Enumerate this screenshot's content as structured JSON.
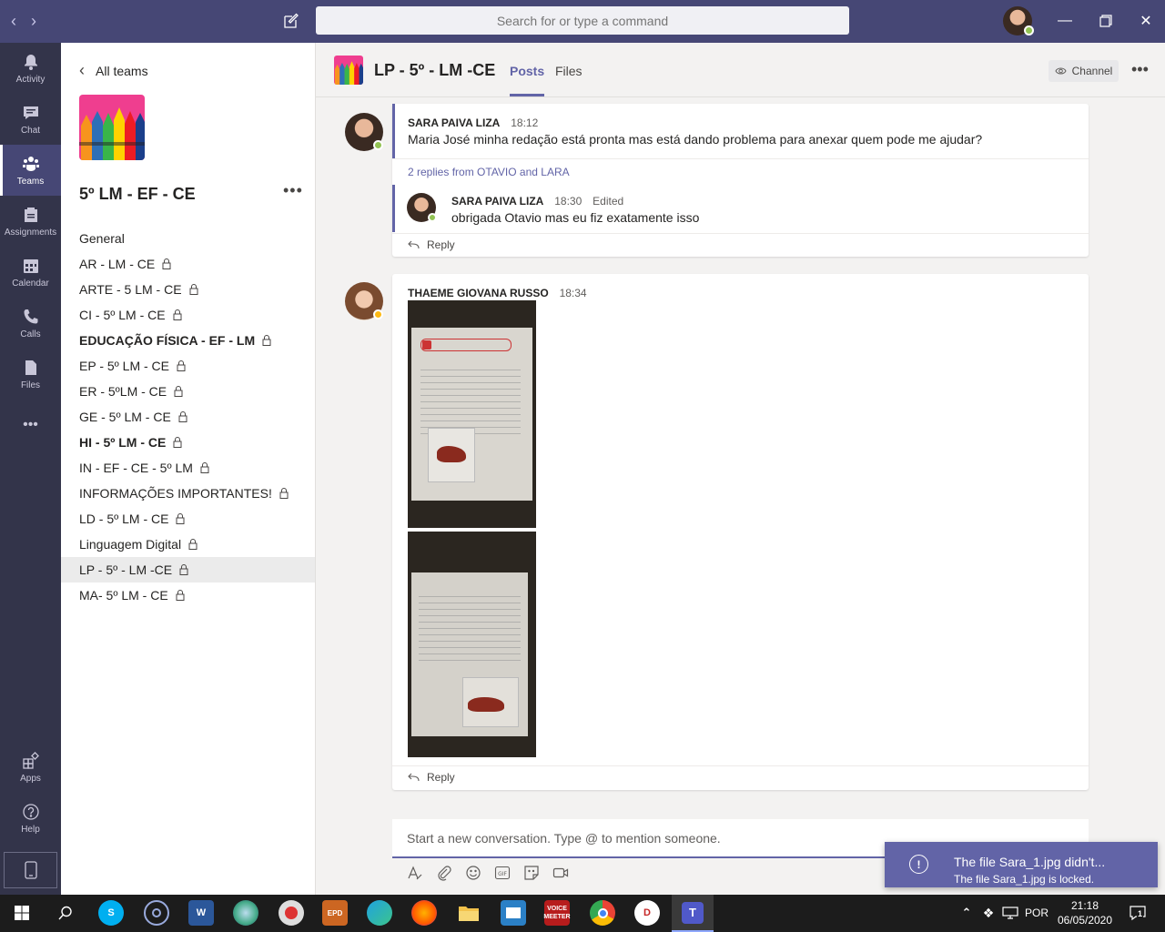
{
  "titlebar": {
    "search_placeholder": "Search for or type a command"
  },
  "appbar": {
    "items": [
      {
        "label": "Activity",
        "icon": "bell-icon"
      },
      {
        "label": "Chat",
        "icon": "chat-icon"
      },
      {
        "label": "Teams",
        "icon": "teams-icon"
      },
      {
        "label": "Assignments",
        "icon": "assignments-icon"
      },
      {
        "label": "Calendar",
        "icon": "calendar-icon"
      },
      {
        "label": "Calls",
        "icon": "phone-icon"
      },
      {
        "label": "Files",
        "icon": "file-icon"
      }
    ],
    "more": "•••",
    "bottom": [
      {
        "label": "Apps",
        "icon": "apps-icon"
      },
      {
        "label": "Help",
        "icon": "help-icon"
      }
    ]
  },
  "teampanel": {
    "back_label": "All teams",
    "team_name": "5º LM - EF - CE",
    "more": "•••",
    "channels": [
      {
        "name": "General",
        "locked": false,
        "bold": false
      },
      {
        "name": "AR - LM - CE",
        "locked": true,
        "bold": false
      },
      {
        "name": "ARTE - 5 LM - CE",
        "locked": true,
        "bold": false
      },
      {
        "name": "CI - 5º LM - CE",
        "locked": true,
        "bold": false
      },
      {
        "name": "EDUCAÇÃO FÍSICA - EF - LM",
        "locked": true,
        "bold": true
      },
      {
        "name": "EP - 5º LM - CE",
        "locked": true,
        "bold": false
      },
      {
        "name": "ER - 5ºLM - CE",
        "locked": true,
        "bold": false
      },
      {
        "name": "GE - 5º LM - CE",
        "locked": true,
        "bold": false
      },
      {
        "name": "HI - 5º LM - CE",
        "locked": true,
        "bold": true
      },
      {
        "name": "IN - EF - CE - 5º LM",
        "locked": true,
        "bold": false
      },
      {
        "name": "INFORMAÇÕES IMPORTANTES!",
        "locked": true,
        "bold": false
      },
      {
        "name": "LD - 5º LM - CE",
        "locked": true,
        "bold": false
      },
      {
        "name": "Linguagem Digital",
        "locked": true,
        "bold": false
      },
      {
        "name": "LP - 5º - LM -CE",
        "locked": true,
        "bold": false,
        "selected": true
      },
      {
        "name": "MA- 5º LM - CE",
        "locked": true,
        "bold": false
      }
    ]
  },
  "channel_header": {
    "title": "LP - 5º - LM -CE",
    "tabs": [
      "Posts",
      "Files"
    ],
    "active_tab": "Posts",
    "channel_button": "Channel",
    "more": "•••"
  },
  "posts": [
    {
      "author": "SARA PAIVA LIZA",
      "time": "18:12",
      "text": "Maria José minha redação está pronta mas está dando problema para anexar quem pode me ajudar?",
      "replies_summary": "2 replies from OTAVIO and LARA",
      "reply": {
        "author": "SARA PAIVA LIZA",
        "time": "18:30",
        "edited": "Edited",
        "text": "obrigada Otavio mas eu fiz exatamente isso"
      },
      "reply_label": "Reply"
    },
    {
      "author": "THAEME GIOVANA RUSSO",
      "time": "18:34",
      "images": [
        "notebook-photo-1",
        "notebook-photo-2"
      ],
      "reply_label": "Reply"
    }
  ],
  "compose": {
    "placeholder": "Start a new conversation. Type @ to mention someone."
  },
  "toast": {
    "title": "The file Sara_1.jpg didn't...",
    "message": "The file Sara_1.jpg is locked."
  },
  "taskbar": {
    "lang": "POR",
    "time": "21:18",
    "date": "06/05/2020",
    "notification_count": "1"
  },
  "colors": {
    "brand": "#6264a7",
    "titlebar": "#464775",
    "appbar": "#33344a",
    "presence_available": "#92c353",
    "presence_away": "#fdb913"
  }
}
